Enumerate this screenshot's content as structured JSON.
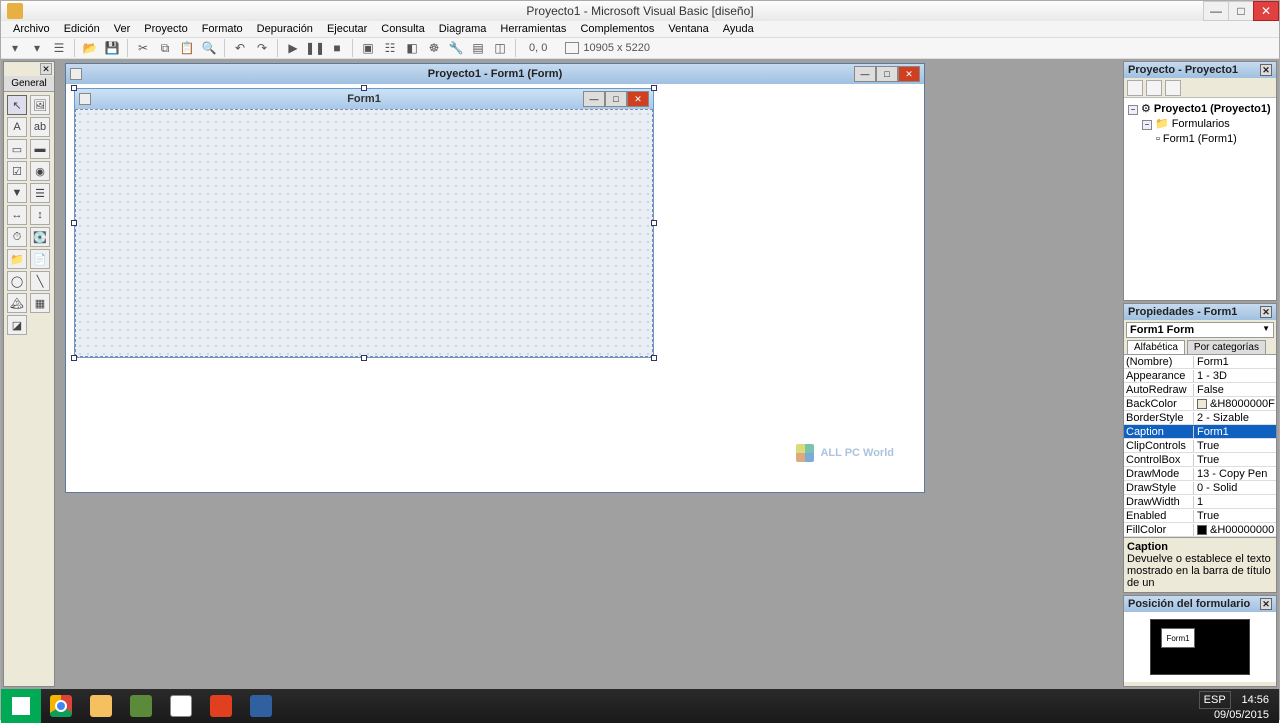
{
  "app": {
    "title": "Proyecto1 - Microsoft Visual Basic [diseño]"
  },
  "menubar": [
    "Archivo",
    "Edición",
    "Ver",
    "Proyecto",
    "Formato",
    "Depuración",
    "Ejecutar",
    "Consulta",
    "Diagrama",
    "Herramientas",
    "Complementos",
    "Ventana",
    "Ayuda"
  ],
  "toolbar": {
    "coords": "0, 0",
    "size": "10905 x 5220"
  },
  "toolbox": {
    "title": "General"
  },
  "mdi": {
    "title": "Proyecto1 - Form1 (Form)"
  },
  "form": {
    "caption": "Form1"
  },
  "watermark": "ALL PC World",
  "project_panel": {
    "title": "Proyecto - Proyecto1",
    "root": "Proyecto1 (Proyecto1)",
    "folder": "Formularios",
    "form": "Form1 (Form1)"
  },
  "props_panel": {
    "title": "Propiedades - Form1",
    "object": "Form1 Form",
    "tabs": [
      "Alfabética",
      "Por categorías"
    ],
    "rows": [
      {
        "name": "(Nombre)",
        "value": "Form1"
      },
      {
        "name": "Appearance",
        "value": "1 - 3D"
      },
      {
        "name": "AutoRedraw",
        "value": "False"
      },
      {
        "name": "BackColor",
        "value": "&H8000000F",
        "swatch": "#ece9d8"
      },
      {
        "name": "BorderStyle",
        "value": "2 - Sizable"
      },
      {
        "name": "Caption",
        "value": "Form1",
        "selected": true
      },
      {
        "name": "ClipControls",
        "value": "True"
      },
      {
        "name": "ControlBox",
        "value": "True"
      },
      {
        "name": "DrawMode",
        "value": "13 - Copy Pen"
      },
      {
        "name": "DrawStyle",
        "value": "0 - Solid"
      },
      {
        "name": "DrawWidth",
        "value": "1"
      },
      {
        "name": "Enabled",
        "value": "True"
      },
      {
        "name": "FillColor",
        "value": "&H00000000",
        "swatch": "#000000"
      }
    ],
    "desc_name": "Caption",
    "desc_text": "Devuelve o establece el texto mostrado en la barra de título de un"
  },
  "formpos_panel": {
    "title": "Posición del formulario",
    "mini": "Form1"
  },
  "systray": {
    "lang": "ESP",
    "time": "14:56",
    "date": "09/05/2015"
  }
}
